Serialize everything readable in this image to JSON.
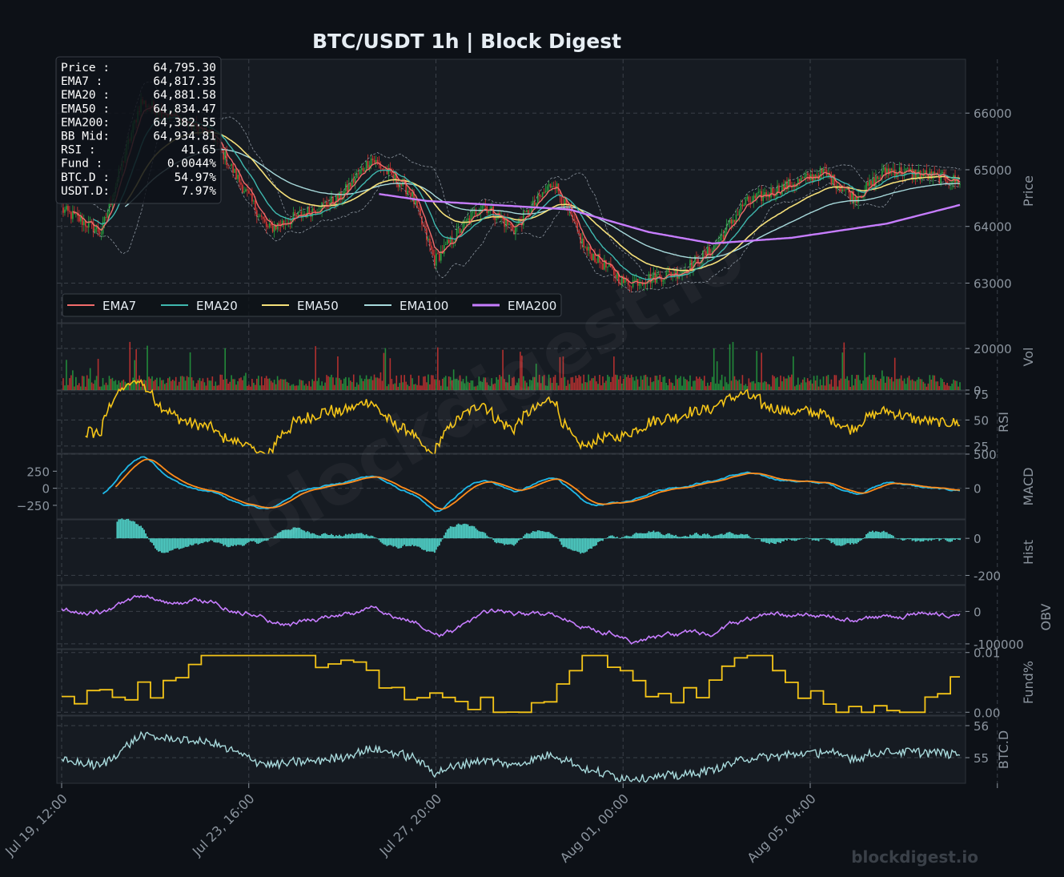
{
  "title": "BTC/USDT  1h  |  Block Digest",
  "watermark": "blockdigest.io",
  "footer_brand": "blockdigest.io",
  "colors": {
    "background": "#0d1117",
    "panel": "#161b22",
    "grid": "#30363d",
    "up": "#26a641",
    "down": "#da3633",
    "ema7": "#f26b6b",
    "ema20": "#3fb8af",
    "ema50": "#f5e07a",
    "ema100": "#a8dadc",
    "ema200": "#c77dff",
    "rsi": "#f5c518",
    "macd": "#1fb8e8",
    "signal": "#ff8c1a",
    "hist": "#4ecdc4",
    "obv": "#c77dff",
    "funding": "#f5c518",
    "btcd": "#a8dadc"
  },
  "info_box": [
    {
      "label": "Price :",
      "value": "64,795.30"
    },
    {
      "label": "EMA7  :",
      "value": "64,817.35"
    },
    {
      "label": "EMA20 :",
      "value": "64,881.58"
    },
    {
      "label": "EMA50 :",
      "value": "64,834.47"
    },
    {
      "label": "EMA200:",
      "value": "64,382.55"
    },
    {
      "label": "BB Mid:",
      "value": "64,934.81"
    },
    {
      "label": "RSI   :",
      "value": "41.65"
    },
    {
      "label": "Fund  :",
      "value": "0.0044%"
    },
    {
      "label": "BTC.D :",
      "value": "54.97%"
    },
    {
      "label": "USDT.D:",
      "value": "7.97%"
    }
  ],
  "legend": [
    "EMA7",
    "EMA20",
    "EMA50",
    "EMA100",
    "EMA200"
  ],
  "x_ticks": [
    "Jul 19, 12:00",
    "Jul 23, 16:00",
    "Jul 27, 20:00",
    "Aug 01, 00:00",
    "Aug 05, 04:00"
  ],
  "chart_data": {
    "type": "line",
    "x_range_hours": 480,
    "panels": [
      {
        "name": "Price",
        "ylabel": "Price",
        "yticks": [
          63000,
          64000,
          65000,
          66000
        ],
        "ylim": [
          62300,
          66950
        ],
        "series": [
          "Candles",
          "EMA7",
          "EMA20",
          "EMA50",
          "EMA100",
          "EMA200",
          "Bollinger Bands"
        ],
        "key_points": [
          {
            "x": 0,
            "close": 64300
          },
          {
            "x": 25,
            "close": 63900
          },
          {
            "x": 50,
            "close": 66200
          },
          {
            "x": 95,
            "close": 65600
          },
          {
            "x": 130,
            "close": 63950
          },
          {
            "x": 175,
            "close": 64500
          },
          {
            "x": 195,
            "close": 65200
          },
          {
            "x": 220,
            "close": 64600
          },
          {
            "x": 235,
            "close": 63400
          },
          {
            "x": 265,
            "close": 64400
          },
          {
            "x": 285,
            "close": 63950
          },
          {
            "x": 310,
            "close": 64800
          },
          {
            "x": 330,
            "close": 63600
          },
          {
            "x": 355,
            "close": 63000
          },
          {
            "x": 390,
            "close": 63200
          },
          {
            "x": 410,
            "close": 63600
          },
          {
            "x": 430,
            "close": 64400
          },
          {
            "x": 455,
            "close": 64700
          },
          {
            "x": 480,
            "close": 64950
          },
          {
            "x": 500,
            "close": 64500
          },
          {
            "x": 520,
            "close": 65000
          },
          {
            "x": 545,
            "close": 64900
          },
          {
            "x": 566,
            "close": 64795
          }
        ],
        "ema200_points": [
          {
            "x": 0,
            "y": 65300
          },
          {
            "x": 120,
            "y": 64900
          },
          {
            "x": 230,
            "y": 64450
          },
          {
            "x": 320,
            "y": 64300
          },
          {
            "x": 370,
            "y": 63900
          },
          {
            "x": 410,
            "y": 63700
          },
          {
            "x": 460,
            "y": 63800
          },
          {
            "x": 520,
            "y": 64050
          },
          {
            "x": 566,
            "y": 64380
          }
        ]
      },
      {
        "name": "Volume",
        "ylabel": "Vol",
        "yticks": [
          0,
          20000
        ],
        "ylim": [
          0,
          32000
        ]
      },
      {
        "name": "RSI",
        "ylabel": "RSI",
        "yticks": [
          25,
          50,
          75
        ],
        "ylim": [
          18,
          78
        ]
      },
      {
        "name": "MACD",
        "ylabel": "MACD",
        "yticks_left": [
          -250,
          0,
          250
        ],
        "yticks_right": [
          0,
          500
        ],
        "ylim": [
          -450,
          500
        ]
      },
      {
        "name": "Histogram",
        "ylabel": "Hist",
        "yticks": [
          -200,
          0
        ],
        "ylim": [
          -250,
          100
        ]
      },
      {
        "name": "OBV",
        "ylabel": "OBV",
        "yticks": [
          -100000,
          0
        ],
        "ylim": [
          -115000,
          80000
        ]
      },
      {
        "name": "Funding",
        "ylabel": "Fund%",
        "yticks": [
          0.0,
          0.01
        ],
        "ylim": [
          -0.0005,
          0.0105
        ]
      },
      {
        "name": "BTC.D",
        "ylabel": "BTC.D",
        "yticks": [
          55,
          56
        ],
        "ylim": [
          54.2,
          56.3
        ]
      }
    ]
  }
}
